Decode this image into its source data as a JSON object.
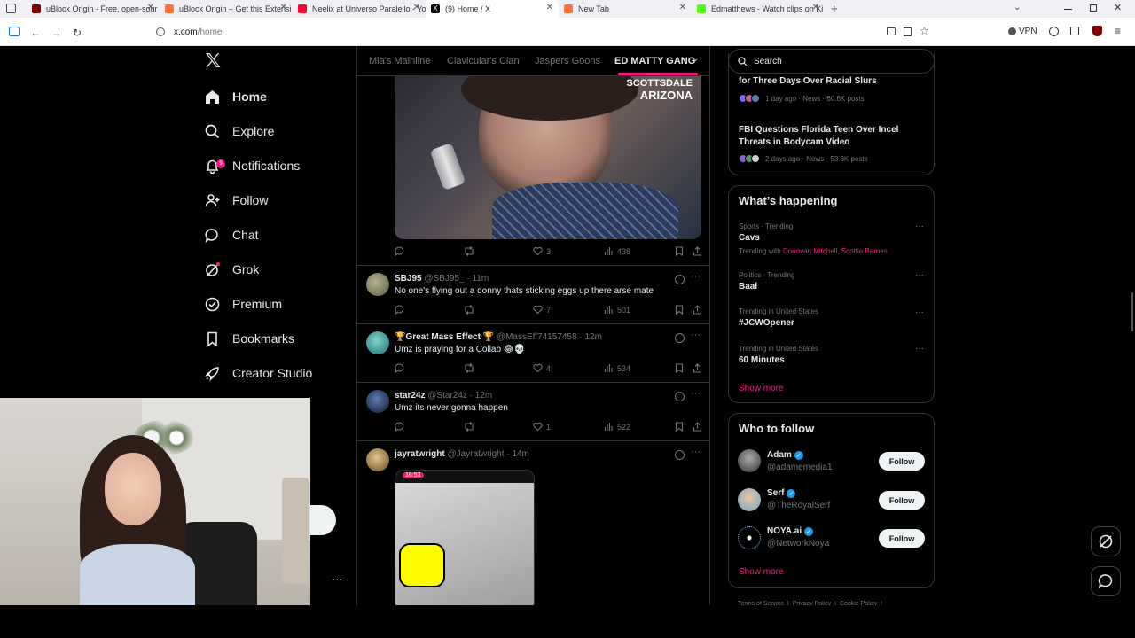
{
  "browser": {
    "tabs": [
      {
        "title": "uBlock Origin - Free, open-sour",
        "favicon_color": "#800000"
      },
      {
        "title": "uBlock Origin – Get this Extensi",
        "favicon_color": "#ff7139"
      },
      {
        "title": "Neelix at Universo Paralello - Yo",
        "favicon_color": "#ff0033"
      },
      {
        "title": "(9) Home / X",
        "favicon_color": "#000000"
      },
      {
        "title": "New Tab",
        "favicon_color": "#ff7139"
      },
      {
        "title": "Edmatthews - Watch clips on Ki",
        "favicon_color": "#53fc18"
      }
    ],
    "new_tab_icon": "plus-icon",
    "url_host": "x.com",
    "url_path": "/home",
    "vpn_label": "VPN"
  },
  "nav": {
    "items": [
      {
        "label": "Home",
        "icon": "home-icon"
      },
      {
        "label": "Explore",
        "icon": "search-icon"
      },
      {
        "label": "Notifications",
        "icon": "bell-icon",
        "badge": "9"
      },
      {
        "label": "Follow",
        "icon": "follow-icon"
      },
      {
        "label": "Chat",
        "icon": "chat-icon"
      },
      {
        "label": "Grok",
        "icon": "grok-icon"
      },
      {
        "label": "Premium",
        "icon": "premium-icon"
      },
      {
        "label": "Bookmarks",
        "icon": "bookmark-icon"
      },
      {
        "label": "Creator Studio",
        "icon": "rocket-icon"
      }
    ],
    "more_dots": "…"
  },
  "feed": {
    "tabs": [
      "Mia's Mainline",
      "Clavicular's Clan",
      "Jaspers Goons",
      "ED MATTY GANG"
    ],
    "first_image_caption_1": "SCOTTSDALE",
    "first_image_caption_2": "ARIZONA",
    "first_tweet_stats": {
      "likes": "3",
      "views": "438"
    },
    "tweets": [
      {
        "name": "SBJ95",
        "handle": "@SBJ95_",
        "time": "11m",
        "text": "No one's flying out a donny thats sticking eggs up there arse mate",
        "likes": "7",
        "views": "501",
        "avatar_color": "#8a8a70"
      },
      {
        "name": "🏆Great Mass Effect 🏆",
        "handle": "@MassEff74157458",
        "time": "12m",
        "text": "Umz is praying for a Collab 😂💀",
        "likes": "4",
        "views": "534",
        "avatar_color": "#2a9fa8"
      },
      {
        "name": "star24z",
        "handle": "@Star24z",
        "time": "12m",
        "text": "Umz its never gonna happen",
        "likes": "1",
        "views": "522",
        "avatar_color": "#2b3a55"
      },
      {
        "name": "jayratwright",
        "handle": "@Jayratwright",
        "time": "14m",
        "text": "",
        "likes": "",
        "views": "",
        "avatar_color": "#b08a55"
      }
    ],
    "phone_time": "16:53"
  },
  "right": {
    "search_placeholder": "Search",
    "news": [
      {
        "title": "for Three Days Over Racial Slurs",
        "meta": "1 day ago · News · 60.6K posts"
      },
      {
        "title": "FBI Questions Florida Teen Over Incel Threats in Bodycam Video",
        "meta": "2 days ago · News · 53.3K posts"
      }
    ],
    "whats_happening_title": "What’s happening",
    "trends": [
      {
        "category": "Sports · Trending",
        "name": "Cavs",
        "with_prefix": "Trending with ",
        "with_1": "Donovan Mitchell",
        "with_sep": ", ",
        "with_2": "Scottie Barnes"
      },
      {
        "category": "Politics · Trending",
        "name": "Baal"
      },
      {
        "category": "Trending in United States",
        "name": "#JCWOpener"
      },
      {
        "category": "Trending in United States",
        "name": "60 Minutes"
      }
    ],
    "show_more": "Show more",
    "who_to_follow_title": "Who to follow",
    "follow_suggestions": [
      {
        "name": "Adam",
        "handle": "@adamemedia1",
        "button": "Follow",
        "avatar_color": "#555"
      },
      {
        "name": "Serf",
        "handle": "@TheRoyalSerf",
        "button": "Follow",
        "avatar_color": "#6aa0c8"
      },
      {
        "name": "NOYA.ai",
        "handle": "@NetworkNoya",
        "button": "Follow",
        "avatar_color": "#000"
      }
    ],
    "footer": "Terms of Service  |  Privacy Policy  |  Cookie Policy  |"
  },
  "colors": {
    "accent": "#f91880",
    "verified": "#1d9bf0"
  }
}
